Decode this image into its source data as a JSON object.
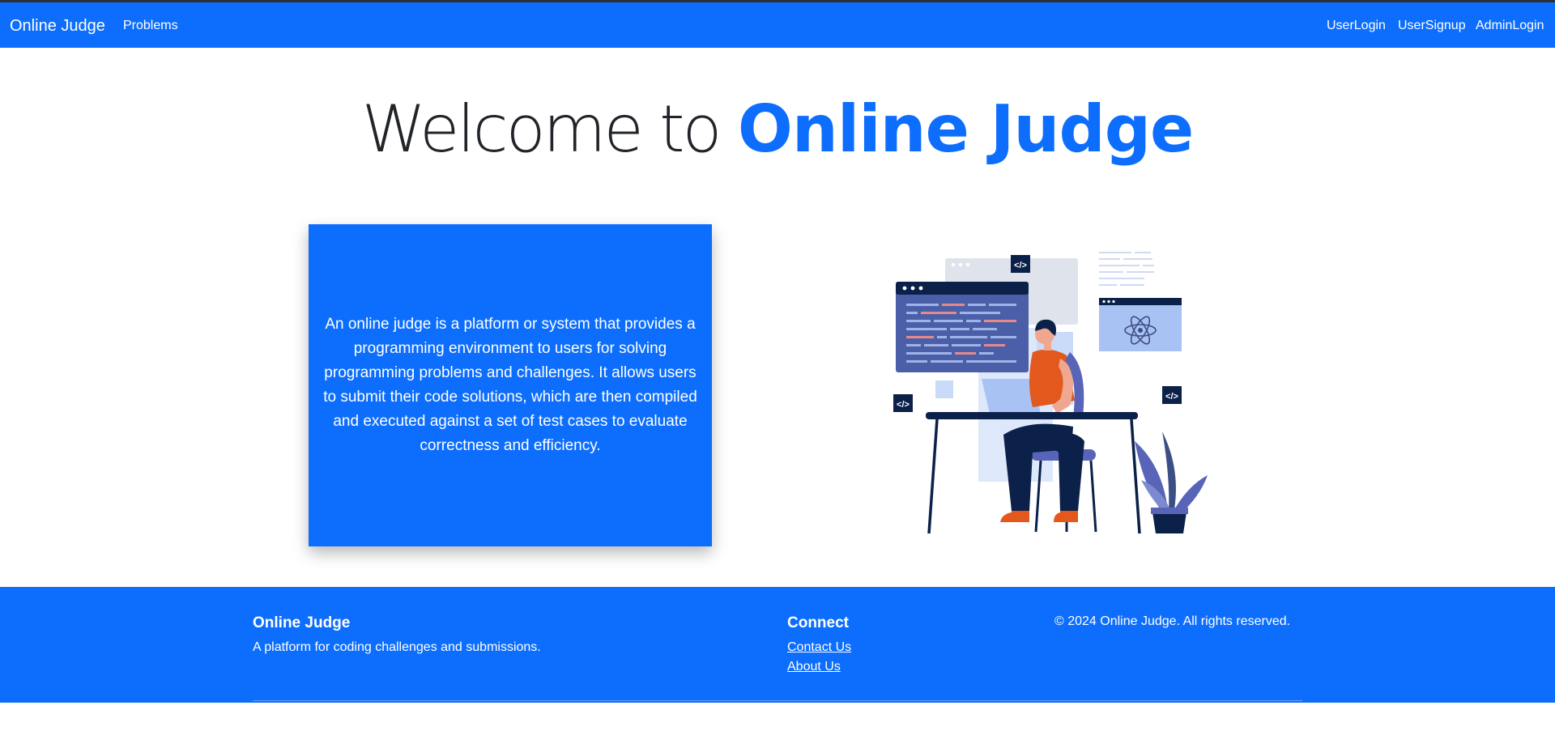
{
  "navbar": {
    "brand": "Online Judge",
    "links": {
      "problems": "Problems",
      "user_login": "UserLogin",
      "user_signup": "UserSignup",
      "admin_login": "AdminLogin"
    }
  },
  "hero": {
    "prefix": "Welcome to ",
    "highlight": "Online Judge"
  },
  "info_card": {
    "text": "An online judge is a platform or system that provides a programming environment to users for solving programming problems and challenges. It allows users to submit their code solutions, which are then compiled and executed against a set of test cases to evaluate correctness and efficiency."
  },
  "illustration": {
    "icon": "developer-at-desk-illustration",
    "code_tag": "</>"
  },
  "footer": {
    "brand_title": "Online Judge",
    "brand_desc": "A platform for coding challenges and submissions.",
    "connect_title": "Connect",
    "links": {
      "contact": "Contact Us",
      "about": "About Us"
    },
    "copyright": "© 2024 Online Judge. All rights reserved."
  },
  "colors": {
    "primary": "#0d6efd",
    "text_dark": "#212529",
    "navy": "#0b2149",
    "orange": "#e2581d"
  }
}
